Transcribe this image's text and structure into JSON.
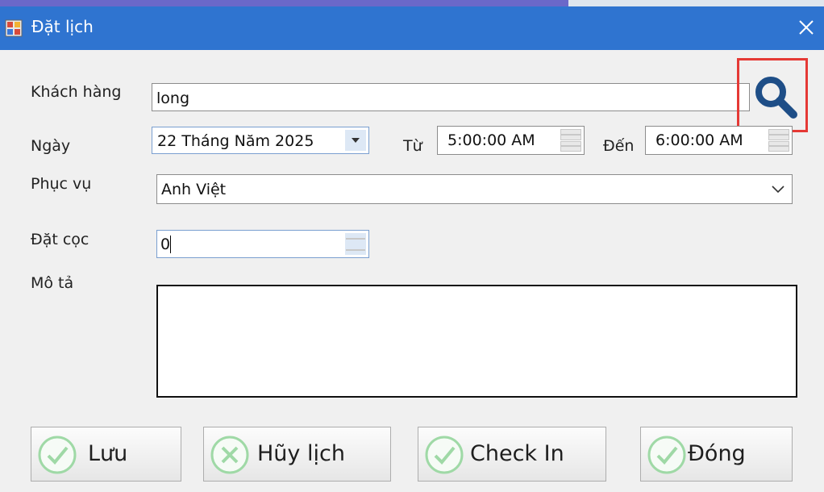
{
  "window": {
    "title": "Đặt lịch"
  },
  "form": {
    "customer_label": "Khách hàng",
    "customer_value": "long",
    "date_label": "Ngày",
    "date_value": "22 Tháng Năm 2025",
    "from_label": "Từ",
    "from_value": "5:00:00 AM",
    "to_label": "Đến",
    "to_value": "6:00:00 AM",
    "staff_label": "Phục vụ",
    "staff_value": "Anh Việt",
    "deposit_label": "Đặt cọc",
    "deposit_value": "0",
    "description_label": "Mô tả",
    "description_value": ""
  },
  "buttons": {
    "save": "Lưu",
    "cancel_booking": "Hũy lịch",
    "check_in": "Check In",
    "close": "Đóng"
  },
  "icons": {
    "app": "app-icon",
    "close": "close-icon",
    "search": "search-icon",
    "check": "check-circle-icon",
    "cancel": "x-circle-icon"
  },
  "colors": {
    "titlebar": "#2f74d0",
    "highlight": "#e53935",
    "search_icon": "#1e4e87",
    "button_icon": "#9fd9a6"
  }
}
